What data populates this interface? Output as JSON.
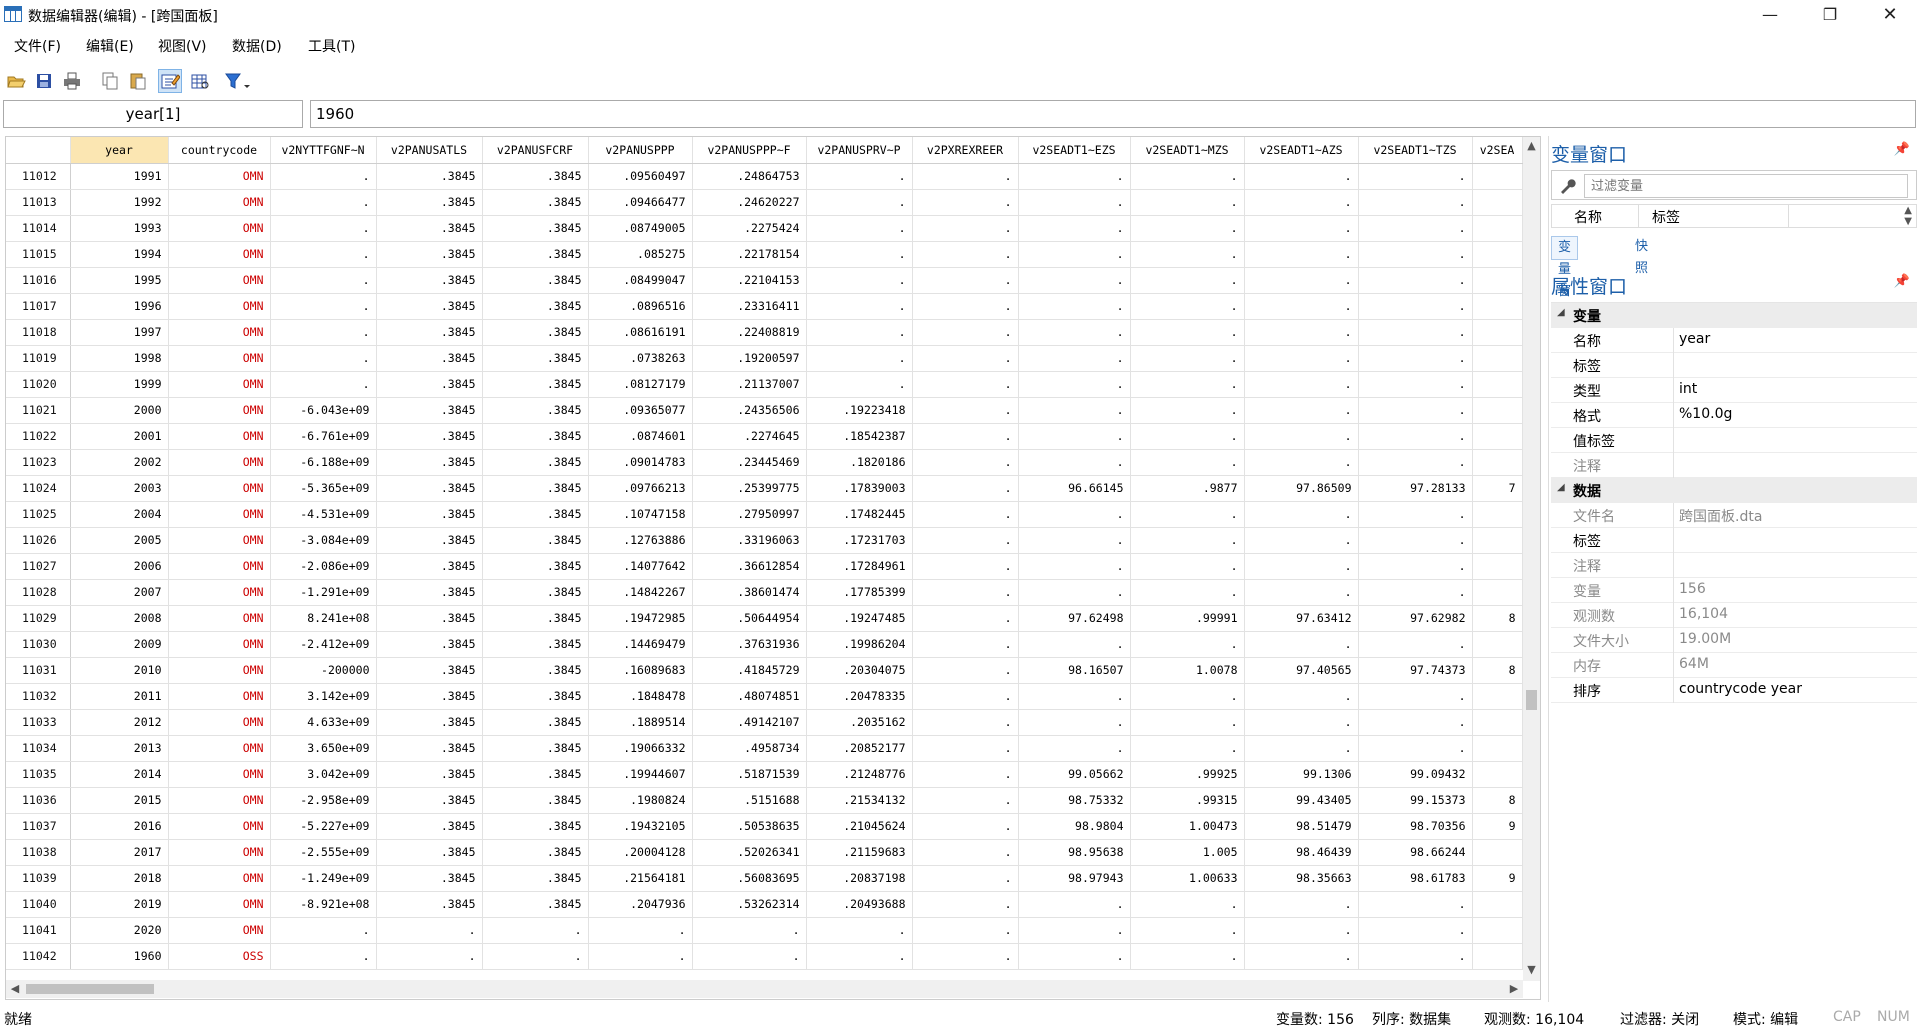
{
  "window": {
    "title": "数据编辑器(编辑) - [跨国面板]",
    "minimize": "—",
    "maximize": "❐",
    "close": "✕"
  },
  "menu": [
    "文件(F)",
    "编辑(E)",
    "视图(V)",
    "数据(D)",
    "工具(T)"
  ],
  "toolbar": {
    "icons": [
      "open-folder-icon",
      "save-icon",
      "print-icon",
      "copy-icon",
      "paste-icon",
      "edit-mode-icon",
      "browse-mode-icon",
      "filter-icon"
    ],
    "active": "edit-mode-icon"
  },
  "cellbar": {
    "name": "year[1]",
    "value": "1960"
  },
  "grid": {
    "columns": [
      "year",
      "countrycode",
      "v2NYTTFGNF~N",
      "v2PANUSATLS",
      "v2PANUSFCRF",
      "v2PANUSPPP",
      "v2PANUSPPP~F",
      "v2PANUSPRV~P",
      "v2PXREXREER",
      "v2SEADT1~EZS",
      "v2SEADT1~MZS",
      "v2SEADT1~AZS",
      "v2SEADT1~TZS",
      "v2SEA"
    ],
    "selected_column": "year",
    "rows": [
      [
        "11012",
        "1991",
        "OMN",
        ".",
        ".3845",
        ".3845",
        ".09560497",
        ".24864753",
        ".",
        ".",
        ".",
        ".",
        ".",
        ".",
        ""
      ],
      [
        "11013",
        "1992",
        "OMN",
        ".",
        ".3845",
        ".3845",
        ".09466477",
        ".24620227",
        ".",
        ".",
        ".",
        ".",
        ".",
        ".",
        ""
      ],
      [
        "11014",
        "1993",
        "OMN",
        ".",
        ".3845",
        ".3845",
        ".08749005",
        ".2275424",
        ".",
        ".",
        ".",
        ".",
        ".",
        ".",
        ""
      ],
      [
        "11015",
        "1994",
        "OMN",
        ".",
        ".3845",
        ".3845",
        ".085275",
        ".22178154",
        ".",
        ".",
        ".",
        ".",
        ".",
        ".",
        ""
      ],
      [
        "11016",
        "1995",
        "OMN",
        ".",
        ".3845",
        ".3845",
        ".08499047",
        ".22104153",
        ".",
        ".",
        ".",
        ".",
        ".",
        ".",
        ""
      ],
      [
        "11017",
        "1996",
        "OMN",
        ".",
        ".3845",
        ".3845",
        ".0896516",
        ".23316411",
        ".",
        ".",
        ".",
        ".",
        ".",
        ".",
        ""
      ],
      [
        "11018",
        "1997",
        "OMN",
        ".",
        ".3845",
        ".3845",
        ".08616191",
        ".22408819",
        ".",
        ".",
        ".",
        ".",
        ".",
        ".",
        ""
      ],
      [
        "11019",
        "1998",
        "OMN",
        ".",
        ".3845",
        ".3845",
        ".0738263",
        ".19200597",
        ".",
        ".",
        ".",
        ".",
        ".",
        ".",
        ""
      ],
      [
        "11020",
        "1999",
        "OMN",
        ".",
        ".3845",
        ".3845",
        ".08127179",
        ".21137007",
        ".",
        ".",
        ".",
        ".",
        ".",
        ".",
        ""
      ],
      [
        "11021",
        "2000",
        "OMN",
        "-6.043e+09",
        ".3845",
        ".3845",
        ".09365077",
        ".24356506",
        ".19223418",
        ".",
        ".",
        ".",
        ".",
        ".",
        ""
      ],
      [
        "11022",
        "2001",
        "OMN",
        "-6.761e+09",
        ".3845",
        ".3845",
        ".0874601",
        ".2274645",
        ".18542387",
        ".",
        ".",
        ".",
        ".",
        ".",
        ""
      ],
      [
        "11023",
        "2002",
        "OMN",
        "-6.188e+09",
        ".3845",
        ".3845",
        ".09014783",
        ".23445469",
        ".1820186",
        ".",
        ".",
        ".",
        ".",
        ".",
        ""
      ],
      [
        "11024",
        "2003",
        "OMN",
        "-5.365e+09",
        ".3845",
        ".3845",
        ".09766213",
        ".25399775",
        ".17839003",
        ".",
        "96.66145",
        ".9877",
        "97.86509",
        "97.28133",
        "7"
      ],
      [
        "11025",
        "2004",
        "OMN",
        "-4.531e+09",
        ".3845",
        ".3845",
        ".10747158",
        ".27950997",
        ".17482445",
        ".",
        ".",
        ".",
        ".",
        ".",
        ""
      ],
      [
        "11026",
        "2005",
        "OMN",
        "-3.084e+09",
        ".3845",
        ".3845",
        ".12763886",
        ".33196063",
        ".17231703",
        ".",
        ".",
        ".",
        ".",
        ".",
        ""
      ],
      [
        "11027",
        "2006",
        "OMN",
        "-2.086e+09",
        ".3845",
        ".3845",
        ".14077642",
        ".36612854",
        ".17284961",
        ".",
        ".",
        ".",
        ".",
        ".",
        ""
      ],
      [
        "11028",
        "2007",
        "OMN",
        "-1.291e+09",
        ".3845",
        ".3845",
        ".14842267",
        ".38601474",
        ".17785399",
        ".",
        ".",
        ".",
        ".",
        ".",
        ""
      ],
      [
        "11029",
        "2008",
        "OMN",
        "8.241e+08",
        ".3845",
        ".3845",
        ".19472985",
        ".50644954",
        ".19247485",
        ".",
        "97.62498",
        ".99991",
        "97.63412",
        "97.62982",
        "8"
      ],
      [
        "11030",
        "2009",
        "OMN",
        "-2.412e+09",
        ".3845",
        ".3845",
        ".14469479",
        ".37631936",
        ".19986204",
        ".",
        ".",
        ".",
        ".",
        ".",
        ""
      ],
      [
        "11031",
        "2010",
        "OMN",
        "-200000",
        ".3845",
        ".3845",
        ".16089683",
        ".41845729",
        ".20304075",
        ".",
        "98.16507",
        "1.0078",
        "97.40565",
        "97.74373",
        "8"
      ],
      [
        "11032",
        "2011",
        "OMN",
        "3.142e+09",
        ".3845",
        ".3845",
        ".1848478",
        ".48074851",
        ".20478335",
        ".",
        ".",
        ".",
        ".",
        ".",
        ""
      ],
      [
        "11033",
        "2012",
        "OMN",
        "4.633e+09",
        ".3845",
        ".3845",
        ".1889514",
        ".49142107",
        ".2035162",
        ".",
        ".",
        ".",
        ".",
        ".",
        ""
      ],
      [
        "11034",
        "2013",
        "OMN",
        "3.650e+09",
        ".3845",
        ".3845",
        ".19066332",
        ".4958734",
        ".20852177",
        ".",
        ".",
        ".",
        ".",
        ".",
        ""
      ],
      [
        "11035",
        "2014",
        "OMN",
        "3.042e+09",
        ".3845",
        ".3845",
        ".19944607",
        ".51871539",
        ".21248776",
        ".",
        "99.05662",
        ".99925",
        "99.1306",
        "99.09432",
        ""
      ],
      [
        "11036",
        "2015",
        "OMN",
        "-2.958e+09",
        ".3845",
        ".3845",
        ".1980824",
        ".5151688",
        ".21534132",
        ".",
        "98.75332",
        ".99315",
        "99.43405",
        "99.15373",
        "8"
      ],
      [
        "11037",
        "2016",
        "OMN",
        "-5.227e+09",
        ".3845",
        ".3845",
        ".19432105",
        ".50538635",
        ".21045624",
        ".",
        "98.9804",
        "1.00473",
        "98.51479",
        "98.70356",
        "9"
      ],
      [
        "11038",
        "2017",
        "OMN",
        "-2.555e+09",
        ".3845",
        ".3845",
        ".20004128",
        ".52026341",
        ".21159683",
        ".",
        "98.95638",
        "1.005",
        "98.46439",
        "98.66244",
        ""
      ],
      [
        "11039",
        "2018",
        "OMN",
        "-1.249e+09",
        ".3845",
        ".3845",
        ".21564181",
        ".56083695",
        ".20837198",
        ".",
        "98.97943",
        "1.00633",
        "98.35663",
        "98.61783",
        "9"
      ],
      [
        "11040",
        "2019",
        "OMN",
        "-8.921e+08",
        ".3845",
        ".3845",
        ".2047936",
        ".53262314",
        ".20493688",
        ".",
        ".",
        ".",
        ".",
        ".",
        ""
      ],
      [
        "11041",
        "2020",
        "OMN",
        ".",
        ".",
        ".",
        ".",
        ".",
        ".",
        ".",
        ".",
        ".",
        ".",
        ".",
        ""
      ],
      [
        "11042",
        "1960",
        "OSS",
        ".",
        ".",
        ".",
        ".",
        ".",
        ".",
        ".",
        ".",
        ".",
        ".",
        ".",
        ""
      ]
    ],
    "vscroll_position": 0.68,
    "hscroll_position": 0.0
  },
  "var_window": {
    "title": "变量窗口",
    "filter_placeholder": "过滤变量",
    "col_name": "名称",
    "col_label": "标签",
    "tabs": [
      "变量窗口",
      "快照"
    ],
    "active_tab": "变量窗口"
  },
  "prop_window": {
    "title": "属性窗口",
    "sections": [
      {
        "name": "变量",
        "rows": [
          {
            "k": "名称",
            "v": "year",
            "grey": false
          },
          {
            "k": "标签",
            "v": "",
            "grey": false
          },
          {
            "k": "类型",
            "v": "int",
            "grey": false
          },
          {
            "k": "格式",
            "v": "%10.0g",
            "grey": false
          },
          {
            "k": "值标签",
            "v": "",
            "grey": false
          },
          {
            "k": "注释",
            "v": "",
            "grey": true
          }
        ]
      },
      {
        "name": "数据",
        "rows": [
          {
            "k": "文件名",
            "v": "跨国面板.dta",
            "grey": true
          },
          {
            "k": "标签",
            "v": "",
            "grey": false
          },
          {
            "k": "注释",
            "v": "",
            "grey": true
          },
          {
            "k": "变量",
            "v": "156",
            "grey": true
          },
          {
            "k": "观测数",
            "v": "16,104",
            "grey": true
          },
          {
            "k": "文件大小",
            "v": "19.00M",
            "grey": true
          },
          {
            "k": "内存",
            "v": "64M",
            "grey": true
          },
          {
            "k": "排序",
            "v": "countrycode year",
            "grey": false
          }
        ]
      }
    ]
  },
  "status": {
    "ready": "就绪",
    "vars": "变量数:  156",
    "order": "列序:  数据集",
    "obs": "观测数:  16,104",
    "filter": "过滤器:  关闭",
    "mode": "模式:  编辑",
    "cap": "CAP",
    "num": "NUM"
  }
}
